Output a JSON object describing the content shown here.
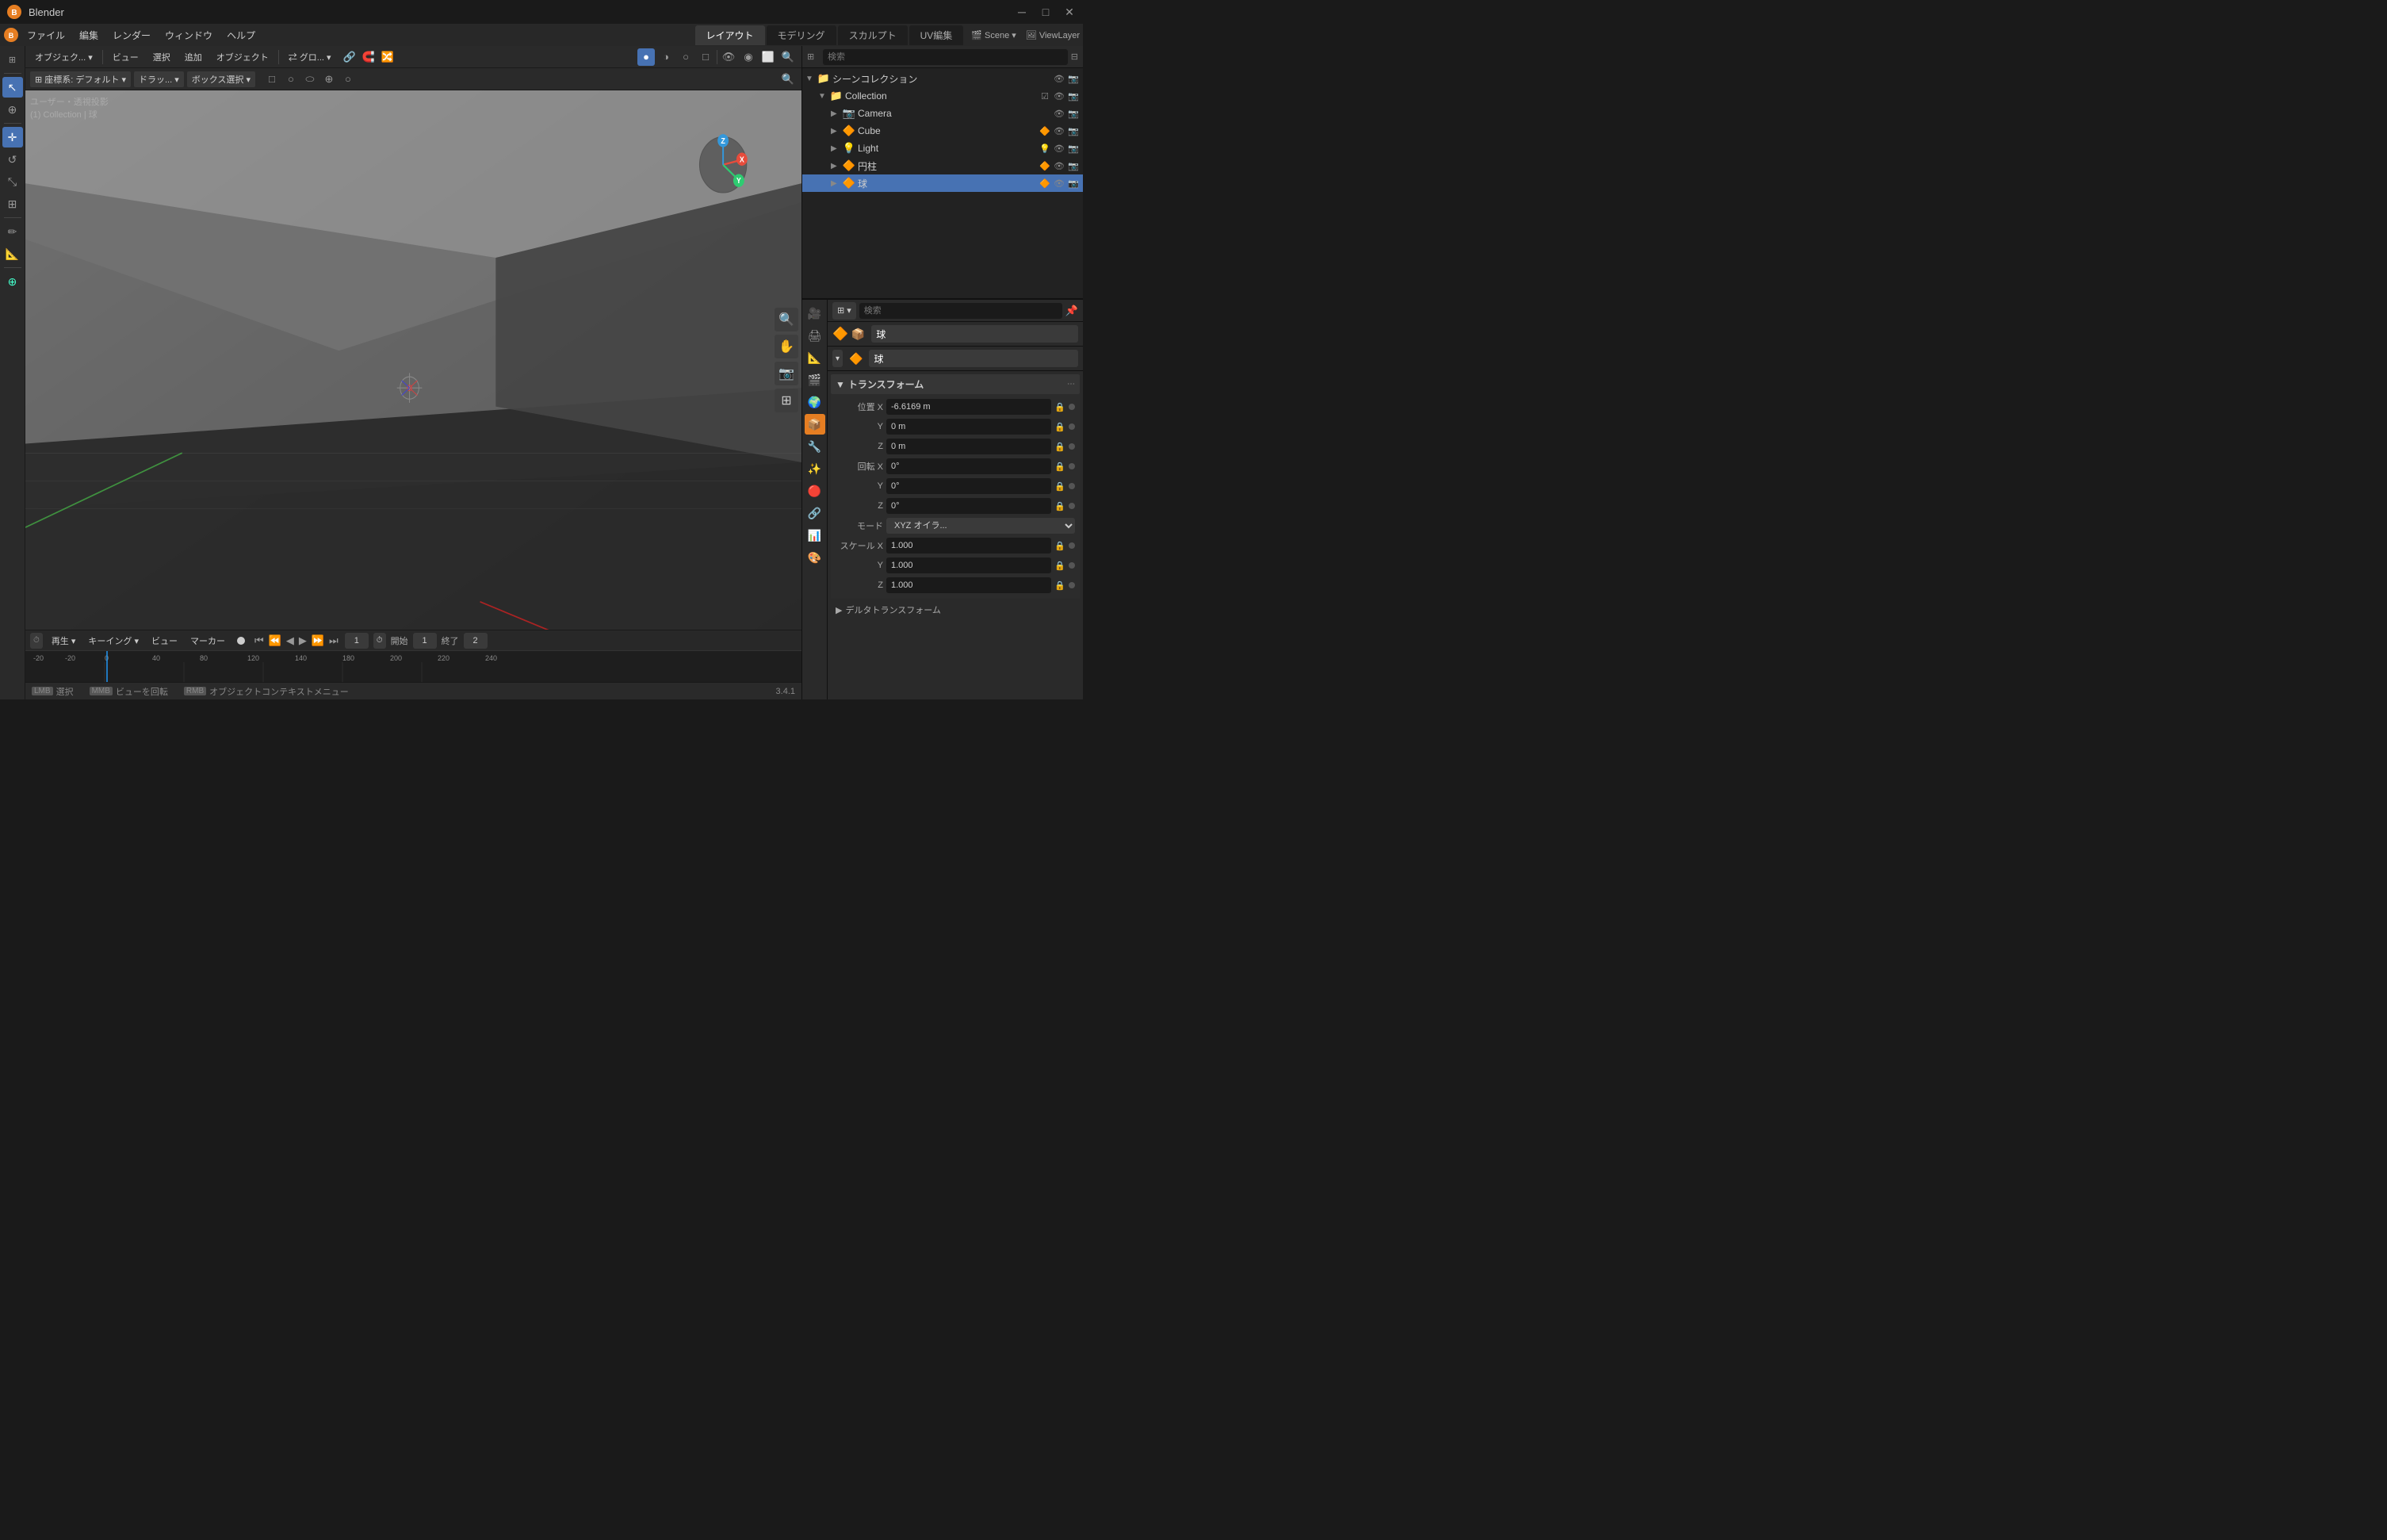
{
  "titlebar": {
    "appname": "Blender",
    "minimize": "─",
    "maximize": "□",
    "close": "✕"
  },
  "menubar": {
    "items": [
      "ファイル",
      "編集",
      "レンダー",
      "ウィンドウ",
      "ヘルプ"
    ],
    "workspace_tabs": [
      "レイアウト",
      "モデリング",
      "スカルプト",
      "UV編集"
    ],
    "scene_label": "Scene",
    "viewlayer_label": "ViewLayer"
  },
  "viewport": {
    "label_view": "ユーザー・透視投影",
    "label_collection": "(1) Collection | 球",
    "header_items": [
      "オブジェク...",
      "ビュー",
      "選択",
      "追加",
      "オブジェクト"
    ],
    "global_label": "グロ...",
    "secondary": {
      "transform": "デフォルト",
      "snap": "ドラッ...",
      "select": "ボックス選択"
    }
  },
  "outliner": {
    "search_placeholder": "検索",
    "title": "シーンコレクション",
    "items": [
      {
        "name": "Collection",
        "type": "collection",
        "icon": "📁",
        "expanded": true,
        "children": [
          {
            "name": "Camera",
            "type": "camera",
            "icon": "📷"
          },
          {
            "name": "Cube",
            "type": "mesh",
            "icon": "🔶"
          },
          {
            "name": "Light",
            "type": "light",
            "icon": "💡"
          },
          {
            "name": "円柱",
            "type": "mesh",
            "icon": "🔶"
          },
          {
            "name": "球",
            "type": "mesh",
            "icon": "🔶",
            "selected": true
          }
        ]
      }
    ]
  },
  "properties": {
    "search_placeholder": "検索",
    "object_name": "球",
    "object_icon": "🔶",
    "transform_section": "トランスフォーム",
    "location": {
      "label": "位置",
      "x": "-6.6169 m",
      "y": "0 m",
      "z": "0 m"
    },
    "rotation": {
      "label": "回転",
      "x": "0°",
      "y": "0°",
      "z": "0°",
      "mode": "XYZ オイラ..."
    },
    "scale": {
      "label": "スケール",
      "x": "1.000",
      "y": "1.000",
      "z": "1.000"
    },
    "mode_label": "モード",
    "delta_section": "デルタトランスフォーム"
  },
  "timeline": {
    "play_label": "再生",
    "keying_label": "キーイング",
    "view_label": "ビュー",
    "marker_label": "マーカー",
    "frame_current": "1",
    "frame_start_label": "開始",
    "frame_start": "1",
    "frame_end_label": "終了",
    "frame_end": "2"
  },
  "statusbar": {
    "select": "選択",
    "rotate": "ビューを回転",
    "context": "オブジェクトコンテキストメニュー",
    "version": "3.4.1"
  },
  "prop_sidebar_icons": [
    "🔧",
    "🖊",
    "📏",
    "🎨",
    "🌍",
    "📦",
    "🔗",
    "🔴"
  ],
  "colors": {
    "accent": "#4772b3",
    "orange_accent": "#e67e22",
    "bg_dark": "#1a1a1a",
    "bg_mid": "#2a2a2a",
    "bg_light": "#3a3a3a",
    "selected_blue": "#4772b3"
  }
}
